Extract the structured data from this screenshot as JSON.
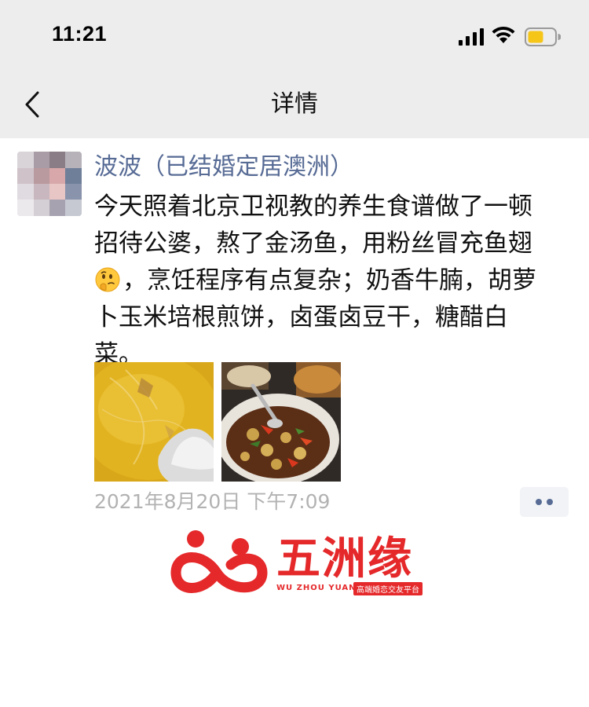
{
  "status_bar": {
    "time": "11:21",
    "icons": [
      "signal-icon",
      "wifi-icon",
      "battery-icon"
    ],
    "battery_color": "#f5c518"
  },
  "nav": {
    "back_icon": "chevron-left-icon",
    "title": "详情"
  },
  "post": {
    "author": "波波（已结婚定居澳洲）",
    "body_lines": [
      "今天照着北京卫视教的养生食谱做了一顿",
      "招待公婆，熬了金汤鱼，用粉丝冒充鱼翅",
      "，烹饪程序有点复杂；奶香牛腩，胡萝",
      "卜玉米培根煎饼，卤蛋卤豆干，糖醋白",
      "菜。"
    ],
    "emoji": "thinking-face-emoji",
    "photos": [
      "fish-soup-photo",
      "beef-stew-photo"
    ],
    "timestamp": "2021年8月20日 下午7:09",
    "more_icon": "more-dots-icon",
    "link_color": "#576b95"
  },
  "watermark": {
    "brand": "五洲缘",
    "pinyin": "WU ZHOU YUAN",
    "tagline": "高端婚恋交友平台",
    "brand_color": "#e5292b"
  }
}
